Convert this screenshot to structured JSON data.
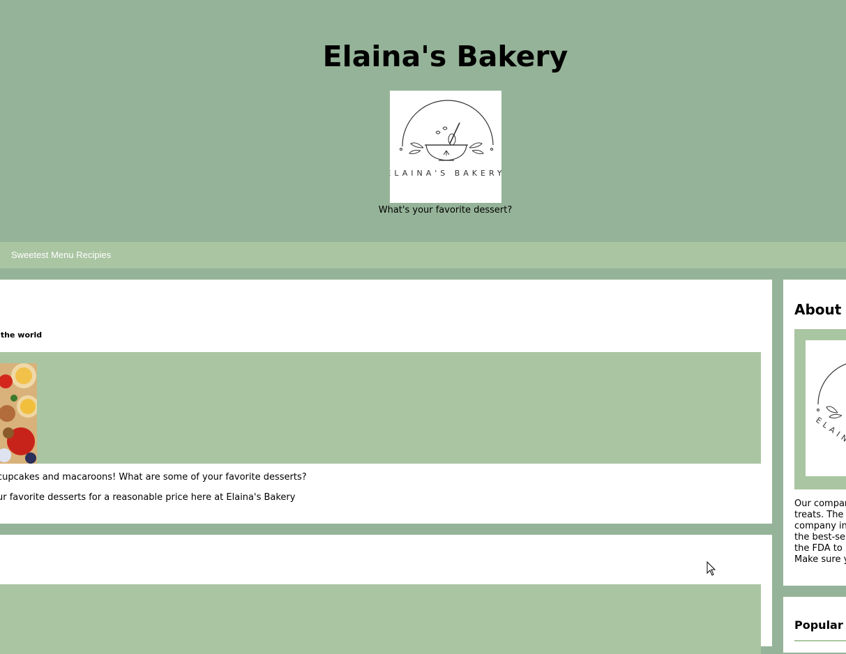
{
  "header": {
    "title": "Elaina's Bakery",
    "logo_text": "ELAINA'S BAKERY",
    "tagline": "What's your favorite dessert?"
  },
  "nav": {
    "links": [
      "Sweetest Menu Recipies"
    ]
  },
  "main": {
    "post": {
      "subtitle": "ound the world",
      "image_icon": "dessert-photo",
      "paragraphs": [
        "cupcakes and macaroons! What are some of your favorite desserts?",
        "ur favorite desserts for a reasonable price here at Elaina's Bakery"
      ]
    }
  },
  "sidebar": {
    "about_title": "About U",
    "about_logo_text": "ELAIN",
    "about_lines": [
      "Our compar",
      "treats. The",
      "company in",
      "the best-sel",
      "the FDA to",
      "Make sure y"
    ],
    "popular_title": "Popular I"
  },
  "colors": {
    "background": "#95b398",
    "accent": "#aac5a2",
    "card": "#ffffff"
  }
}
